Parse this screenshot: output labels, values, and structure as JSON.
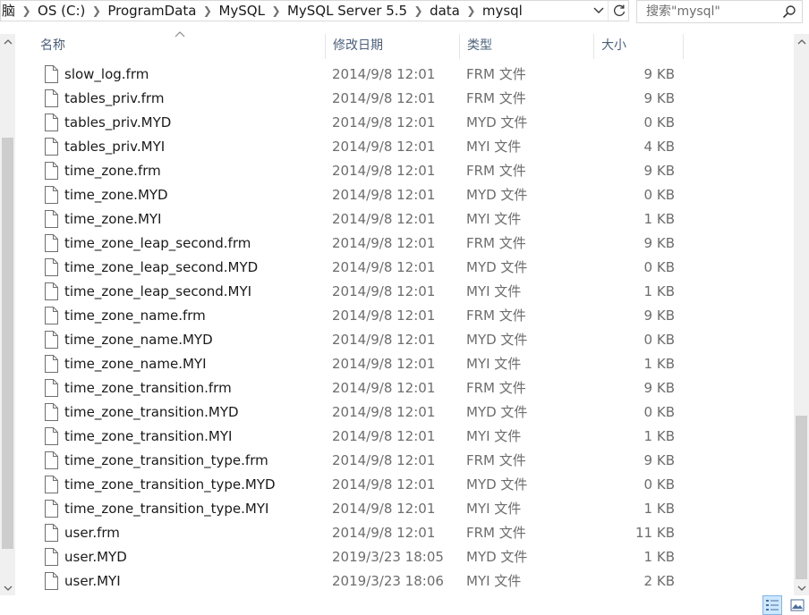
{
  "breadcrumb": [
    "脑",
    "OS (C:)",
    "ProgramData",
    "MySQL",
    "MySQL Server 5.5",
    "data",
    "mysql"
  ],
  "search": {
    "placeholder": "搜索\"mysql\""
  },
  "columns": {
    "name": "名称",
    "date": "修改日期",
    "type": "类型",
    "size": "大小"
  },
  "sort": {
    "column": "name",
    "direction": "ascending"
  },
  "files": [
    {
      "name": "slow_log.frm",
      "date": "2014/9/8 12:01",
      "type": "FRM 文件",
      "size": "9 KB"
    },
    {
      "name": "tables_priv.frm",
      "date": "2014/9/8 12:01",
      "type": "FRM 文件",
      "size": "9 KB"
    },
    {
      "name": "tables_priv.MYD",
      "date": "2014/9/8 12:01",
      "type": "MYD 文件",
      "size": "0 KB"
    },
    {
      "name": "tables_priv.MYI",
      "date": "2014/9/8 12:01",
      "type": "MYI 文件",
      "size": "4 KB"
    },
    {
      "name": "time_zone.frm",
      "date": "2014/9/8 12:01",
      "type": "FRM 文件",
      "size": "9 KB"
    },
    {
      "name": "time_zone.MYD",
      "date": "2014/9/8 12:01",
      "type": "MYD 文件",
      "size": "0 KB"
    },
    {
      "name": "time_zone.MYI",
      "date": "2014/9/8 12:01",
      "type": "MYI 文件",
      "size": "1 KB"
    },
    {
      "name": "time_zone_leap_second.frm",
      "date": "2014/9/8 12:01",
      "type": "FRM 文件",
      "size": "9 KB"
    },
    {
      "name": "time_zone_leap_second.MYD",
      "date": "2014/9/8 12:01",
      "type": "MYD 文件",
      "size": "0 KB"
    },
    {
      "name": "time_zone_leap_second.MYI",
      "date": "2014/9/8 12:01",
      "type": "MYI 文件",
      "size": "1 KB"
    },
    {
      "name": "time_zone_name.frm",
      "date": "2014/9/8 12:01",
      "type": "FRM 文件",
      "size": "9 KB"
    },
    {
      "name": "time_zone_name.MYD",
      "date": "2014/9/8 12:01",
      "type": "MYD 文件",
      "size": "0 KB"
    },
    {
      "name": "time_zone_name.MYI",
      "date": "2014/9/8 12:01",
      "type": "MYI 文件",
      "size": "1 KB"
    },
    {
      "name": "time_zone_transition.frm",
      "date": "2014/9/8 12:01",
      "type": "FRM 文件",
      "size": "9 KB"
    },
    {
      "name": "time_zone_transition.MYD",
      "date": "2014/9/8 12:01",
      "type": "MYD 文件",
      "size": "0 KB"
    },
    {
      "name": "time_zone_transition.MYI",
      "date": "2014/9/8 12:01",
      "type": "MYI 文件",
      "size": "1 KB"
    },
    {
      "name": "time_zone_transition_type.frm",
      "date": "2014/9/8 12:01",
      "type": "FRM 文件",
      "size": "9 KB"
    },
    {
      "name": "time_zone_transition_type.MYD",
      "date": "2014/9/8 12:01",
      "type": "MYD 文件",
      "size": "0 KB"
    },
    {
      "name": "time_zone_transition_type.MYI",
      "date": "2014/9/8 12:01",
      "type": "MYI 文件",
      "size": "1 KB"
    },
    {
      "name": "user.frm",
      "date": "2014/9/8 12:01",
      "type": "FRM 文件",
      "size": "11 KB"
    },
    {
      "name": "user.MYD",
      "date": "2019/3/23 18:05",
      "type": "MYD 文件",
      "size": "1 KB"
    },
    {
      "name": "user.MYI",
      "date": "2019/3/23 18:06",
      "type": "MYI 文件",
      "size": "2 KB"
    }
  ],
  "icons": {
    "file": "file-icon",
    "search": "search-icon",
    "refresh": "refresh-icon",
    "dropdown": "chevron-down-icon",
    "breadcrumb_separator": "chevron-right-icon",
    "view_details": "details-view-icon",
    "view_tiles": "large-icons-view-icon"
  },
  "colors": {
    "header_text": "#4c607a",
    "secondary_text": "#6d6d6d",
    "selected_view_bg": "#cce8ff",
    "selected_view_border": "#7eb4ea"
  }
}
